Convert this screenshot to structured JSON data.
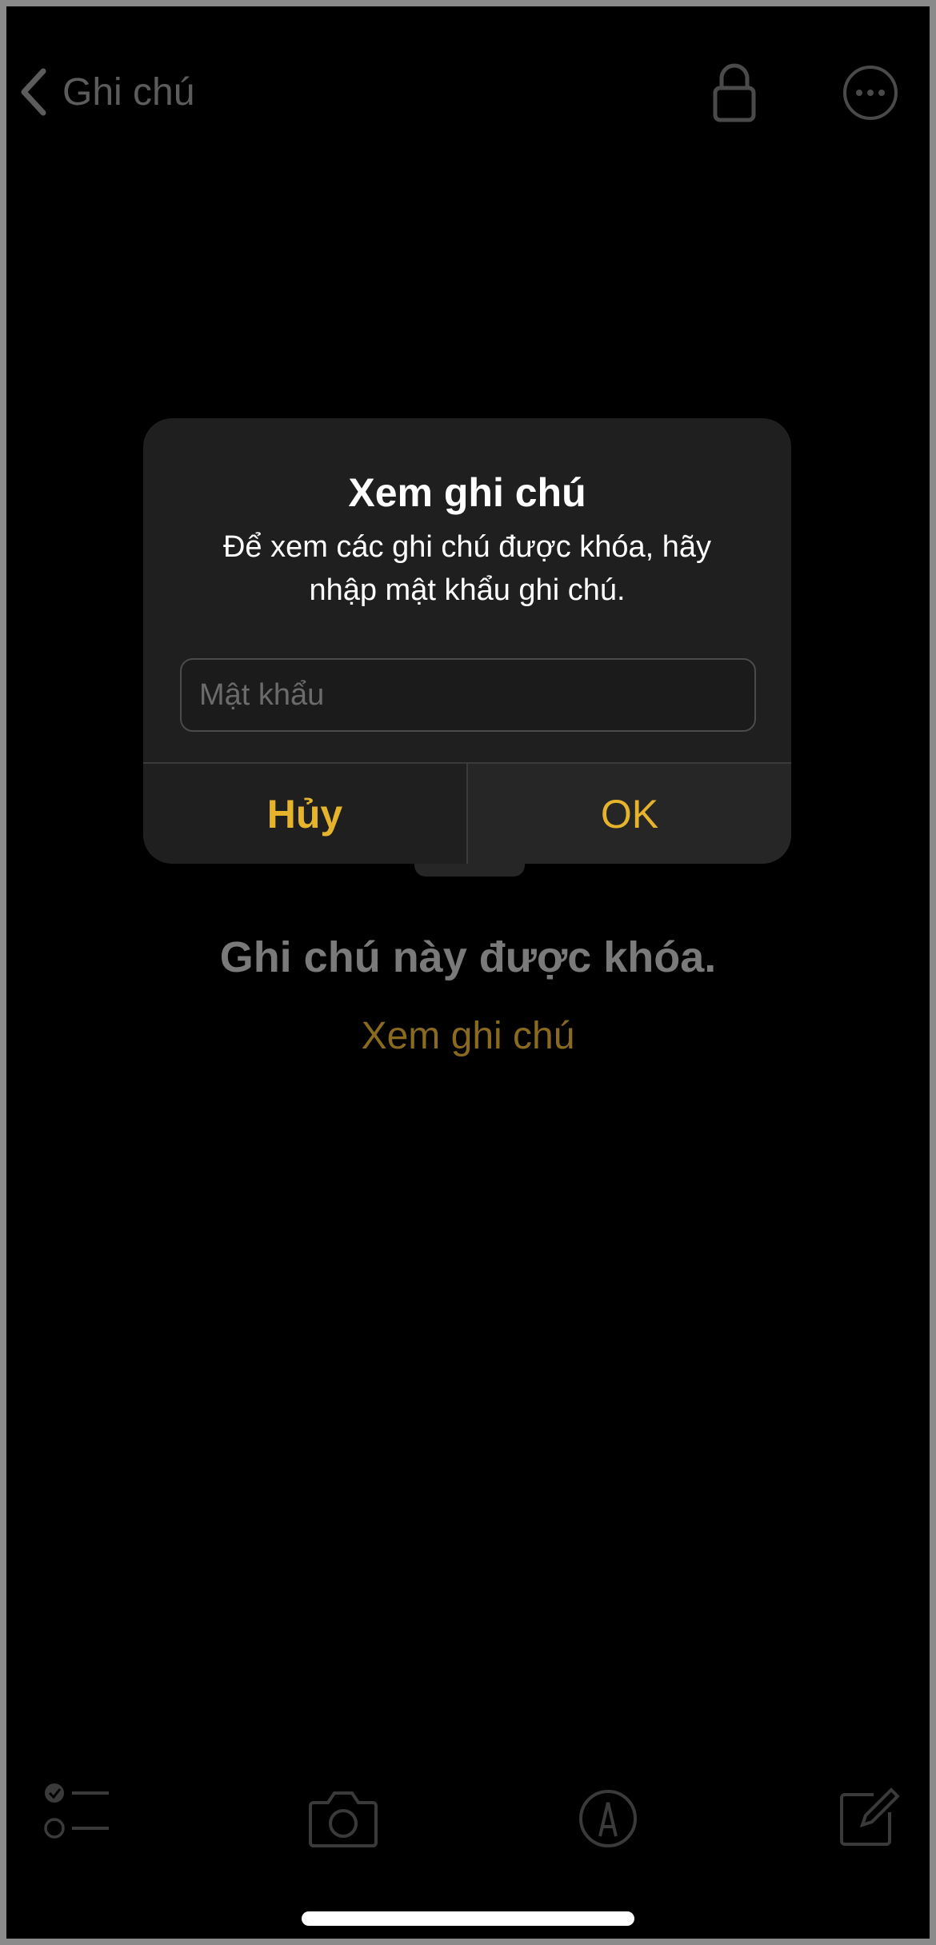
{
  "nav": {
    "back_label": "Ghi chú",
    "lock_icon": "lock-icon",
    "more_icon": "ellipsis-circle-icon"
  },
  "note": {
    "locked_title": "Ghi chú này được khóa.",
    "view_link": "Xem ghi chú"
  },
  "alert": {
    "title": "Xem ghi chú",
    "message": "Để xem các ghi chú được khóa, hãy nhập mật khẩu ghi chú.",
    "password_placeholder": "Mật khẩu",
    "cancel_label": "Hủy",
    "ok_label": "OK"
  },
  "toolbar": {
    "icons": [
      "checklist-icon",
      "camera-icon",
      "markup-pen-icon",
      "compose-icon"
    ]
  },
  "colors": {
    "accent": "#e6b42c",
    "accent_dimmed": "#8a6a1e",
    "background": "#000000",
    "alert_background": "#1f1f1f"
  }
}
